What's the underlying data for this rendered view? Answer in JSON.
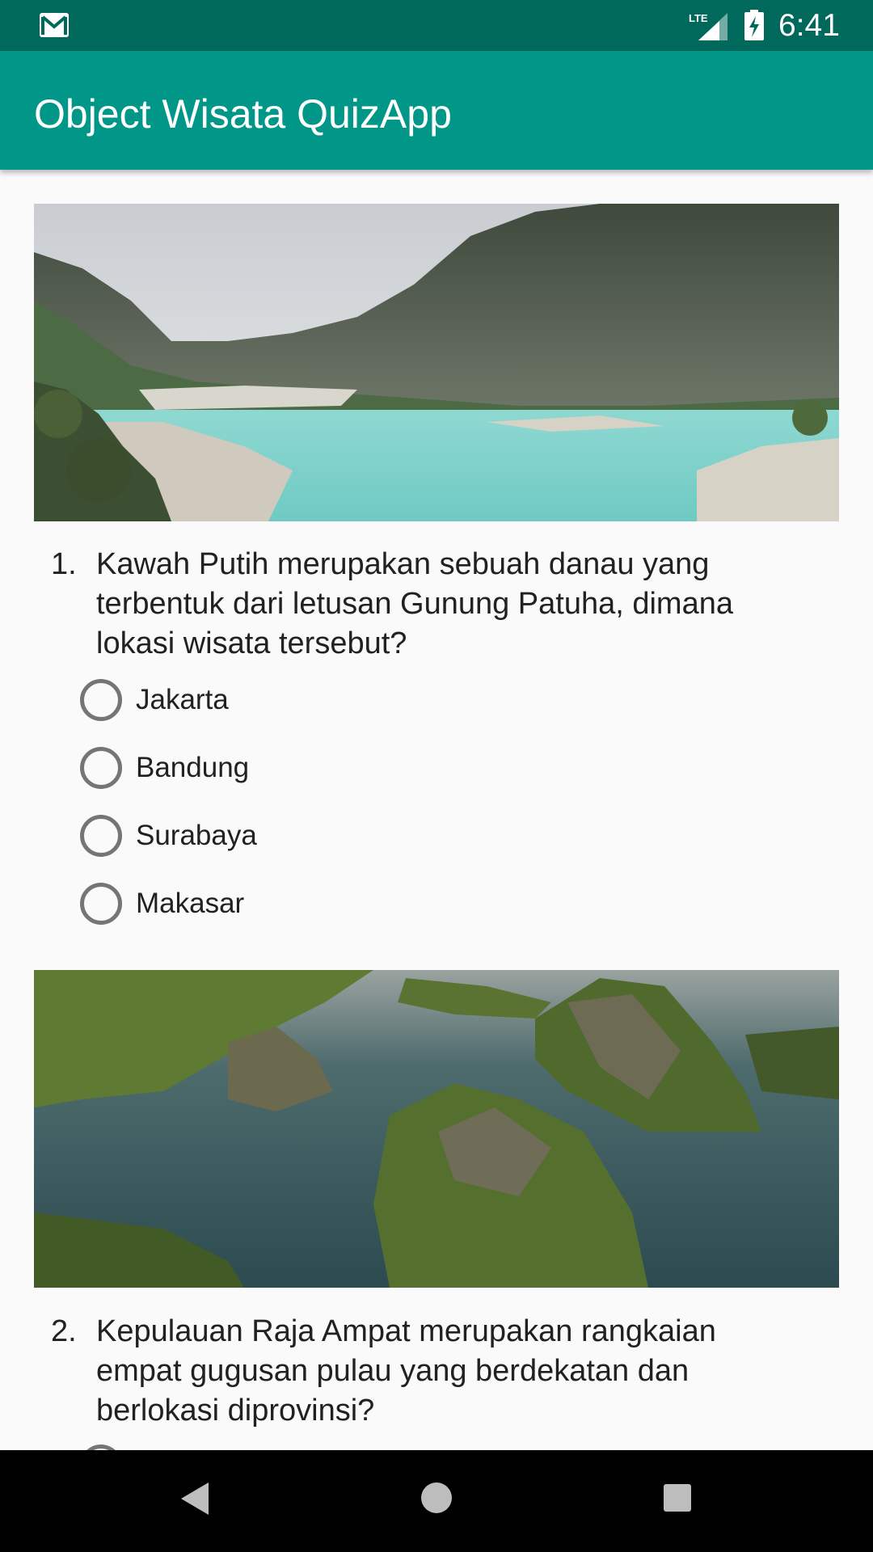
{
  "status_bar": {
    "time": "6:41",
    "network": "LTE",
    "icons": [
      "gmail-icon",
      "lte-signal-icon",
      "battery-charging-icon"
    ]
  },
  "app_bar": {
    "title": "Object Wisata QuizApp",
    "color": "#009688"
  },
  "questions": [
    {
      "number": "1.",
      "text": "Kawah Putih merupakan sebuah danau yang terbentuk dari letusan Gunung Patuha, dimana lokasi wisata tersebut?",
      "options": [
        "Jakarta",
        "Bandung",
        "Surabaya",
        "Makasar"
      ]
    },
    {
      "number": "2.",
      "text": "Kepulauan Raja Ampat merupakan rangkaian empat gugusan pulau yang berdekatan dan berlokasi diprovinsi?",
      "options": []
    }
  ],
  "nav_bar": {
    "icons": [
      "back-icon",
      "home-icon",
      "recents-icon"
    ]
  }
}
